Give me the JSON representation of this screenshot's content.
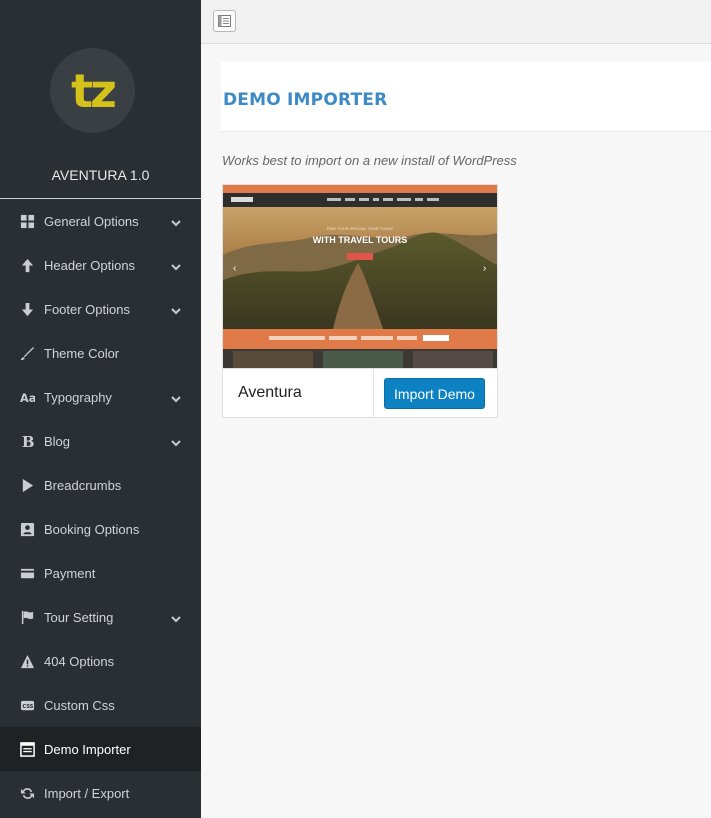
{
  "brand": {
    "logo_text": "tz",
    "version": "AVENTURA 1.0",
    "logo_color": "#d4c21b"
  },
  "sidebar": {
    "items": [
      {
        "label": "General Options",
        "icon": "grid-icon",
        "has_submenu": true
      },
      {
        "label": "Header Options",
        "icon": "arrow-up-icon",
        "has_submenu": true
      },
      {
        "label": "Footer Options",
        "icon": "arrow-down-icon",
        "has_submenu": true
      },
      {
        "label": "Theme Color",
        "icon": "brush-icon",
        "has_submenu": false
      },
      {
        "label": "Typography",
        "icon": "font-icon",
        "has_submenu": true
      },
      {
        "label": "Blog",
        "icon": "bold-b-icon",
        "has_submenu": true
      },
      {
        "label": "Breadcrumbs",
        "icon": "play-icon",
        "has_submenu": false
      },
      {
        "label": "Booking Options",
        "icon": "contact-card-icon",
        "has_submenu": false
      },
      {
        "label": "Payment",
        "icon": "credit-card-icon",
        "has_submenu": false
      },
      {
        "label": "Tour Setting",
        "icon": "flag-icon",
        "has_submenu": true
      },
      {
        "label": "404 Options",
        "icon": "warning-icon",
        "has_submenu": false
      },
      {
        "label": "Custom Css",
        "icon": "css-file-icon",
        "has_submenu": false
      },
      {
        "label": "Demo Importer",
        "icon": "window-icon",
        "has_submenu": false,
        "active": true
      },
      {
        "label": "Import / Export",
        "icon": "refresh-icon",
        "has_submenu": false
      }
    ]
  },
  "main": {
    "title": "DEMO IMPORTER",
    "description": "Works best to import on a new install of WordPress",
    "demos": [
      {
        "name": "Aventura",
        "button_label": "Import Demo",
        "hero_text": "WITH TRAVEL TOURS"
      }
    ]
  },
  "colors": {
    "accent": "#3c8ac6",
    "button": "#0c82c2",
    "sidebar_bg": "#2a2f33"
  }
}
